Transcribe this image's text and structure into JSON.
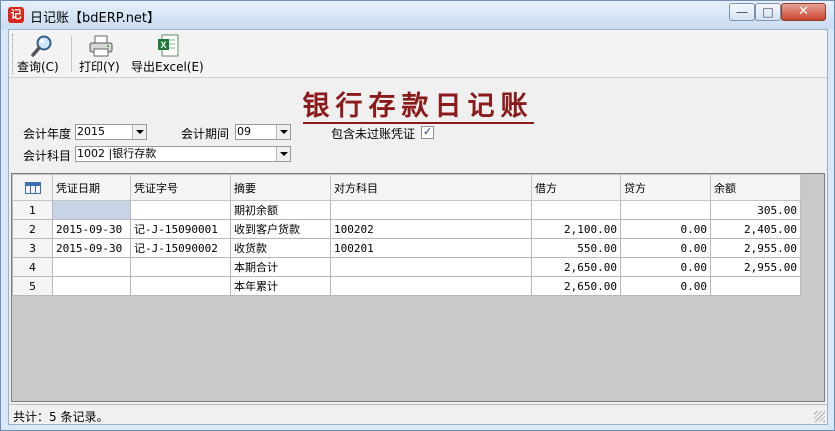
{
  "window": {
    "title": "日记账【bdERP.net】",
    "app_icon_text": "记"
  },
  "toolbar": {
    "query_label": "查询(C)",
    "print_label": "打印(Y)",
    "excel_label": "导出Excel(E)"
  },
  "report": {
    "title": "银行存款日记账"
  },
  "filters": {
    "year_label": "会计年度",
    "year_value": "2015",
    "period_label": "会计期间",
    "period_value": "09",
    "include_unposted_label": "包含未过账凭证",
    "include_unposted_checked": true,
    "account_label": "会计科目",
    "account_value": "1002 |银行存款"
  },
  "table": {
    "columns": [
      "凭证日期",
      "凭证字号",
      "摘要",
      "对方科目",
      "借方",
      "贷方",
      "余额"
    ],
    "rows": [
      {
        "idx": "1",
        "date": "",
        "voucher": "",
        "summary": "期初余额",
        "counter": "",
        "debit": "",
        "credit": "",
        "balance": "305.00"
      },
      {
        "idx": "2",
        "date": "2015-09-30",
        "voucher": "记-J-15090001",
        "summary": "收到客户货款",
        "counter": "100202",
        "debit": "2,100.00",
        "credit": "0.00",
        "balance": "2,405.00"
      },
      {
        "idx": "3",
        "date": "2015-09-30",
        "voucher": "记-J-15090002",
        "summary": "收货款",
        "counter": "100201",
        "debit": "550.00",
        "credit": "0.00",
        "balance": "2,955.00"
      },
      {
        "idx": "4",
        "date": "",
        "voucher": "",
        "summary": "本期合计",
        "counter": "",
        "debit": "2,650.00",
        "credit": "0.00",
        "balance": "2,955.00"
      },
      {
        "idx": "5",
        "date": "",
        "voucher": "",
        "summary": "本年累计",
        "counter": "",
        "debit": "2,650.00",
        "credit": "0.00",
        "balance": ""
      }
    ]
  },
  "status": {
    "text": "共计：5 条记录。"
  },
  "colors": {
    "title_red": "#8b1a1a",
    "selected_cell": "#c7d4e6"
  }
}
